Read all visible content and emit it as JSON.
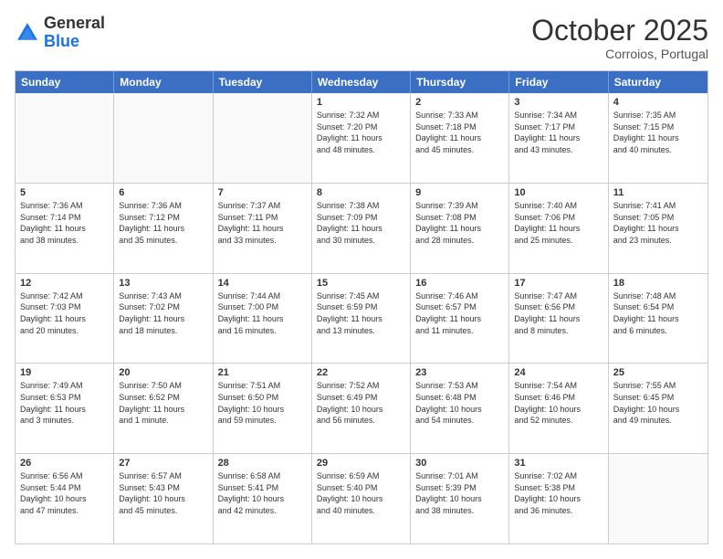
{
  "header": {
    "logo_general": "General",
    "logo_blue": "Blue",
    "month": "October 2025",
    "location": "Corroios, Portugal"
  },
  "weekdays": [
    "Sunday",
    "Monday",
    "Tuesday",
    "Wednesday",
    "Thursday",
    "Friday",
    "Saturday"
  ],
  "rows": [
    [
      {
        "day": "",
        "info": ""
      },
      {
        "day": "",
        "info": ""
      },
      {
        "day": "",
        "info": ""
      },
      {
        "day": "1",
        "info": "Sunrise: 7:32 AM\nSunset: 7:20 PM\nDaylight: 11 hours\nand 48 minutes."
      },
      {
        "day": "2",
        "info": "Sunrise: 7:33 AM\nSunset: 7:18 PM\nDaylight: 11 hours\nand 45 minutes."
      },
      {
        "day": "3",
        "info": "Sunrise: 7:34 AM\nSunset: 7:17 PM\nDaylight: 11 hours\nand 43 minutes."
      },
      {
        "day": "4",
        "info": "Sunrise: 7:35 AM\nSunset: 7:15 PM\nDaylight: 11 hours\nand 40 minutes."
      }
    ],
    [
      {
        "day": "5",
        "info": "Sunrise: 7:36 AM\nSunset: 7:14 PM\nDaylight: 11 hours\nand 38 minutes."
      },
      {
        "day": "6",
        "info": "Sunrise: 7:36 AM\nSunset: 7:12 PM\nDaylight: 11 hours\nand 35 minutes."
      },
      {
        "day": "7",
        "info": "Sunrise: 7:37 AM\nSunset: 7:11 PM\nDaylight: 11 hours\nand 33 minutes."
      },
      {
        "day": "8",
        "info": "Sunrise: 7:38 AM\nSunset: 7:09 PM\nDaylight: 11 hours\nand 30 minutes."
      },
      {
        "day": "9",
        "info": "Sunrise: 7:39 AM\nSunset: 7:08 PM\nDaylight: 11 hours\nand 28 minutes."
      },
      {
        "day": "10",
        "info": "Sunrise: 7:40 AM\nSunset: 7:06 PM\nDaylight: 11 hours\nand 25 minutes."
      },
      {
        "day": "11",
        "info": "Sunrise: 7:41 AM\nSunset: 7:05 PM\nDaylight: 11 hours\nand 23 minutes."
      }
    ],
    [
      {
        "day": "12",
        "info": "Sunrise: 7:42 AM\nSunset: 7:03 PM\nDaylight: 11 hours\nand 20 minutes."
      },
      {
        "day": "13",
        "info": "Sunrise: 7:43 AM\nSunset: 7:02 PM\nDaylight: 11 hours\nand 18 minutes."
      },
      {
        "day": "14",
        "info": "Sunrise: 7:44 AM\nSunset: 7:00 PM\nDaylight: 11 hours\nand 16 minutes."
      },
      {
        "day": "15",
        "info": "Sunrise: 7:45 AM\nSunset: 6:59 PM\nDaylight: 11 hours\nand 13 minutes."
      },
      {
        "day": "16",
        "info": "Sunrise: 7:46 AM\nSunset: 6:57 PM\nDaylight: 11 hours\nand 11 minutes."
      },
      {
        "day": "17",
        "info": "Sunrise: 7:47 AM\nSunset: 6:56 PM\nDaylight: 11 hours\nand 8 minutes."
      },
      {
        "day": "18",
        "info": "Sunrise: 7:48 AM\nSunset: 6:54 PM\nDaylight: 11 hours\nand 6 minutes."
      }
    ],
    [
      {
        "day": "19",
        "info": "Sunrise: 7:49 AM\nSunset: 6:53 PM\nDaylight: 11 hours\nand 3 minutes."
      },
      {
        "day": "20",
        "info": "Sunrise: 7:50 AM\nSunset: 6:52 PM\nDaylight: 11 hours\nand 1 minute."
      },
      {
        "day": "21",
        "info": "Sunrise: 7:51 AM\nSunset: 6:50 PM\nDaylight: 10 hours\nand 59 minutes."
      },
      {
        "day": "22",
        "info": "Sunrise: 7:52 AM\nSunset: 6:49 PM\nDaylight: 10 hours\nand 56 minutes."
      },
      {
        "day": "23",
        "info": "Sunrise: 7:53 AM\nSunset: 6:48 PM\nDaylight: 10 hours\nand 54 minutes."
      },
      {
        "day": "24",
        "info": "Sunrise: 7:54 AM\nSunset: 6:46 PM\nDaylight: 10 hours\nand 52 minutes."
      },
      {
        "day": "25",
        "info": "Sunrise: 7:55 AM\nSunset: 6:45 PM\nDaylight: 10 hours\nand 49 minutes."
      }
    ],
    [
      {
        "day": "26",
        "info": "Sunrise: 6:56 AM\nSunset: 5:44 PM\nDaylight: 10 hours\nand 47 minutes."
      },
      {
        "day": "27",
        "info": "Sunrise: 6:57 AM\nSunset: 5:43 PM\nDaylight: 10 hours\nand 45 minutes."
      },
      {
        "day": "28",
        "info": "Sunrise: 6:58 AM\nSunset: 5:41 PM\nDaylight: 10 hours\nand 42 minutes."
      },
      {
        "day": "29",
        "info": "Sunrise: 6:59 AM\nSunset: 5:40 PM\nDaylight: 10 hours\nand 40 minutes."
      },
      {
        "day": "30",
        "info": "Sunrise: 7:01 AM\nSunset: 5:39 PM\nDaylight: 10 hours\nand 38 minutes."
      },
      {
        "day": "31",
        "info": "Sunrise: 7:02 AM\nSunset: 5:38 PM\nDaylight: 10 hours\nand 36 minutes."
      },
      {
        "day": "",
        "info": ""
      }
    ]
  ]
}
